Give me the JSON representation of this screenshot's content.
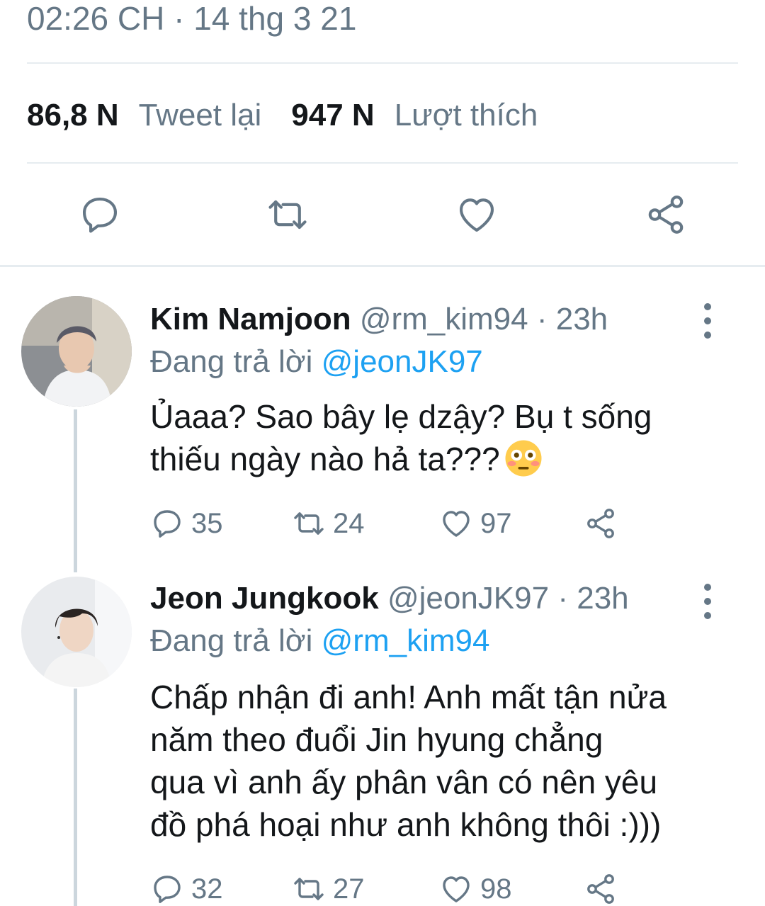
{
  "tweet": {
    "timestamp": "02:26 CH · 14 thg 3 21",
    "retweets_count": "86,8 N",
    "retweets_label": "Tweet lại",
    "likes_count": "947 N",
    "likes_label": "Lượt thích"
  },
  "actions": [
    "reply-icon",
    "retweet-icon",
    "heart-icon",
    "share-icon"
  ],
  "replies": [
    {
      "name": "Kim Namjoon",
      "handle": "@rm_kim94",
      "time": "· 23h",
      "replying_prefix": "Đang trả lời",
      "replying_to": "@jeonJK97",
      "text_lines": [
        "Ủaaa? Sao bây lẹ dzậy? Bụ t sống",
        "thiếu ngày nào hả ta???"
      ],
      "emoji": "flushed-face-emoji",
      "reply_count": "35",
      "retweet_count": "24",
      "like_count": "97"
    },
    {
      "name": "Jeon Jungkook",
      "handle": "@jeonJK97",
      "time": "· 23h",
      "replying_prefix": "Đang trả lời",
      "replying_to": "@rm_kim94",
      "text_lines": [
        "Chấp nhận đi anh! Anh mất tận nửa",
        "năm theo đuổi Jin hyung chẳng",
        "qua vì anh ấy phân vân có nên yêu",
        "đồ phá hoại như anh không thôi :)))"
      ],
      "reply_count": "32",
      "retweet_count": "27",
      "like_count": "98"
    }
  ],
  "colors": {
    "text_primary": "#14171a",
    "text_secondary": "#657786",
    "link": "#1da1f2",
    "divider": "#e6ecf0"
  }
}
